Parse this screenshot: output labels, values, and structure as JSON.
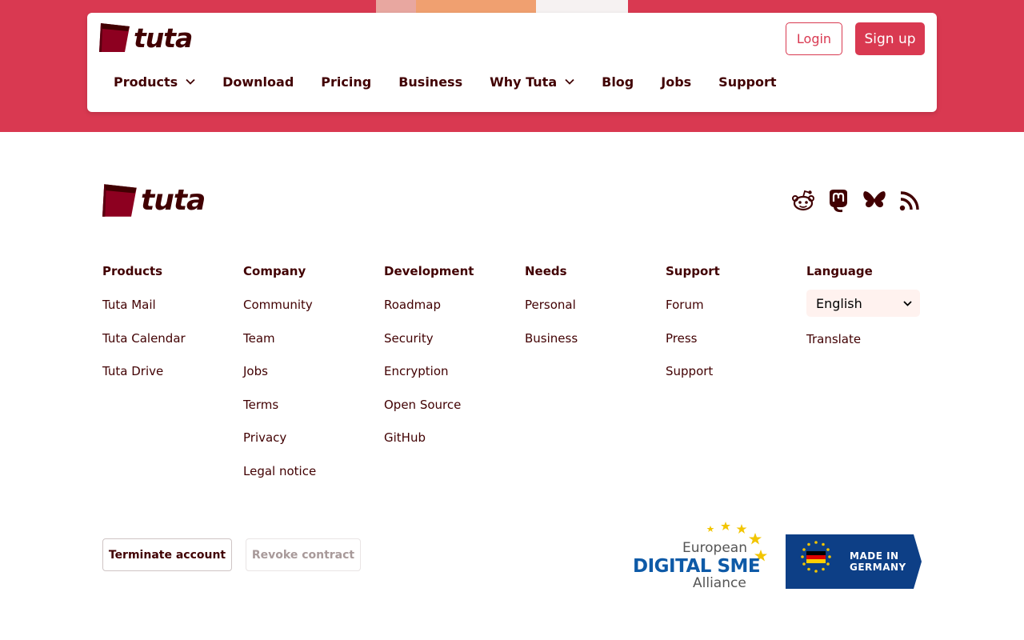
{
  "brand": {
    "name": "tuta",
    "primary_color": "#d93951",
    "dark_color": "#410002"
  },
  "header": {
    "login_label": "Login",
    "signup_label": "Sign up",
    "nav": [
      {
        "label": "Products",
        "dropdown": true
      },
      {
        "label": "Download",
        "dropdown": false
      },
      {
        "label": "Pricing",
        "dropdown": false
      },
      {
        "label": "Business",
        "dropdown": false
      },
      {
        "label": "Why Tuta",
        "dropdown": true
      },
      {
        "label": "Blog",
        "dropdown": false
      },
      {
        "label": "Jobs",
        "dropdown": false
      },
      {
        "label": "Support",
        "dropdown": false
      }
    ]
  },
  "social_icons": [
    "reddit-icon",
    "mastodon-icon",
    "bluesky-icon",
    "rss-icon"
  ],
  "footer": {
    "columns": [
      {
        "title": "Products",
        "links": [
          "Tuta Mail",
          "Tuta Calendar",
          "Tuta Drive"
        ]
      },
      {
        "title": "Company",
        "links": [
          "Community",
          "Team",
          "Jobs",
          "Terms",
          "Privacy",
          "Legal notice"
        ]
      },
      {
        "title": "Development",
        "links": [
          "Roadmap",
          "Security",
          "Encryption",
          "Open Source",
          "GitHub"
        ]
      },
      {
        "title": "Needs",
        "links": [
          "Personal",
          "Business"
        ]
      },
      {
        "title": "Support",
        "links": [
          "Forum",
          "Press",
          "Support"
        ]
      }
    ],
    "language": {
      "title": "Language",
      "selected": "English",
      "translate_label": "Translate"
    },
    "terminate_label": "Terminate account",
    "revoke_label": "Revoke contract",
    "badges": {
      "sme": {
        "line1": "European",
        "line2": "DIGITAL SME",
        "line3": "Alliance"
      },
      "germany": {
        "line1": "MADE IN",
        "line2": "GERMANY"
      }
    }
  }
}
